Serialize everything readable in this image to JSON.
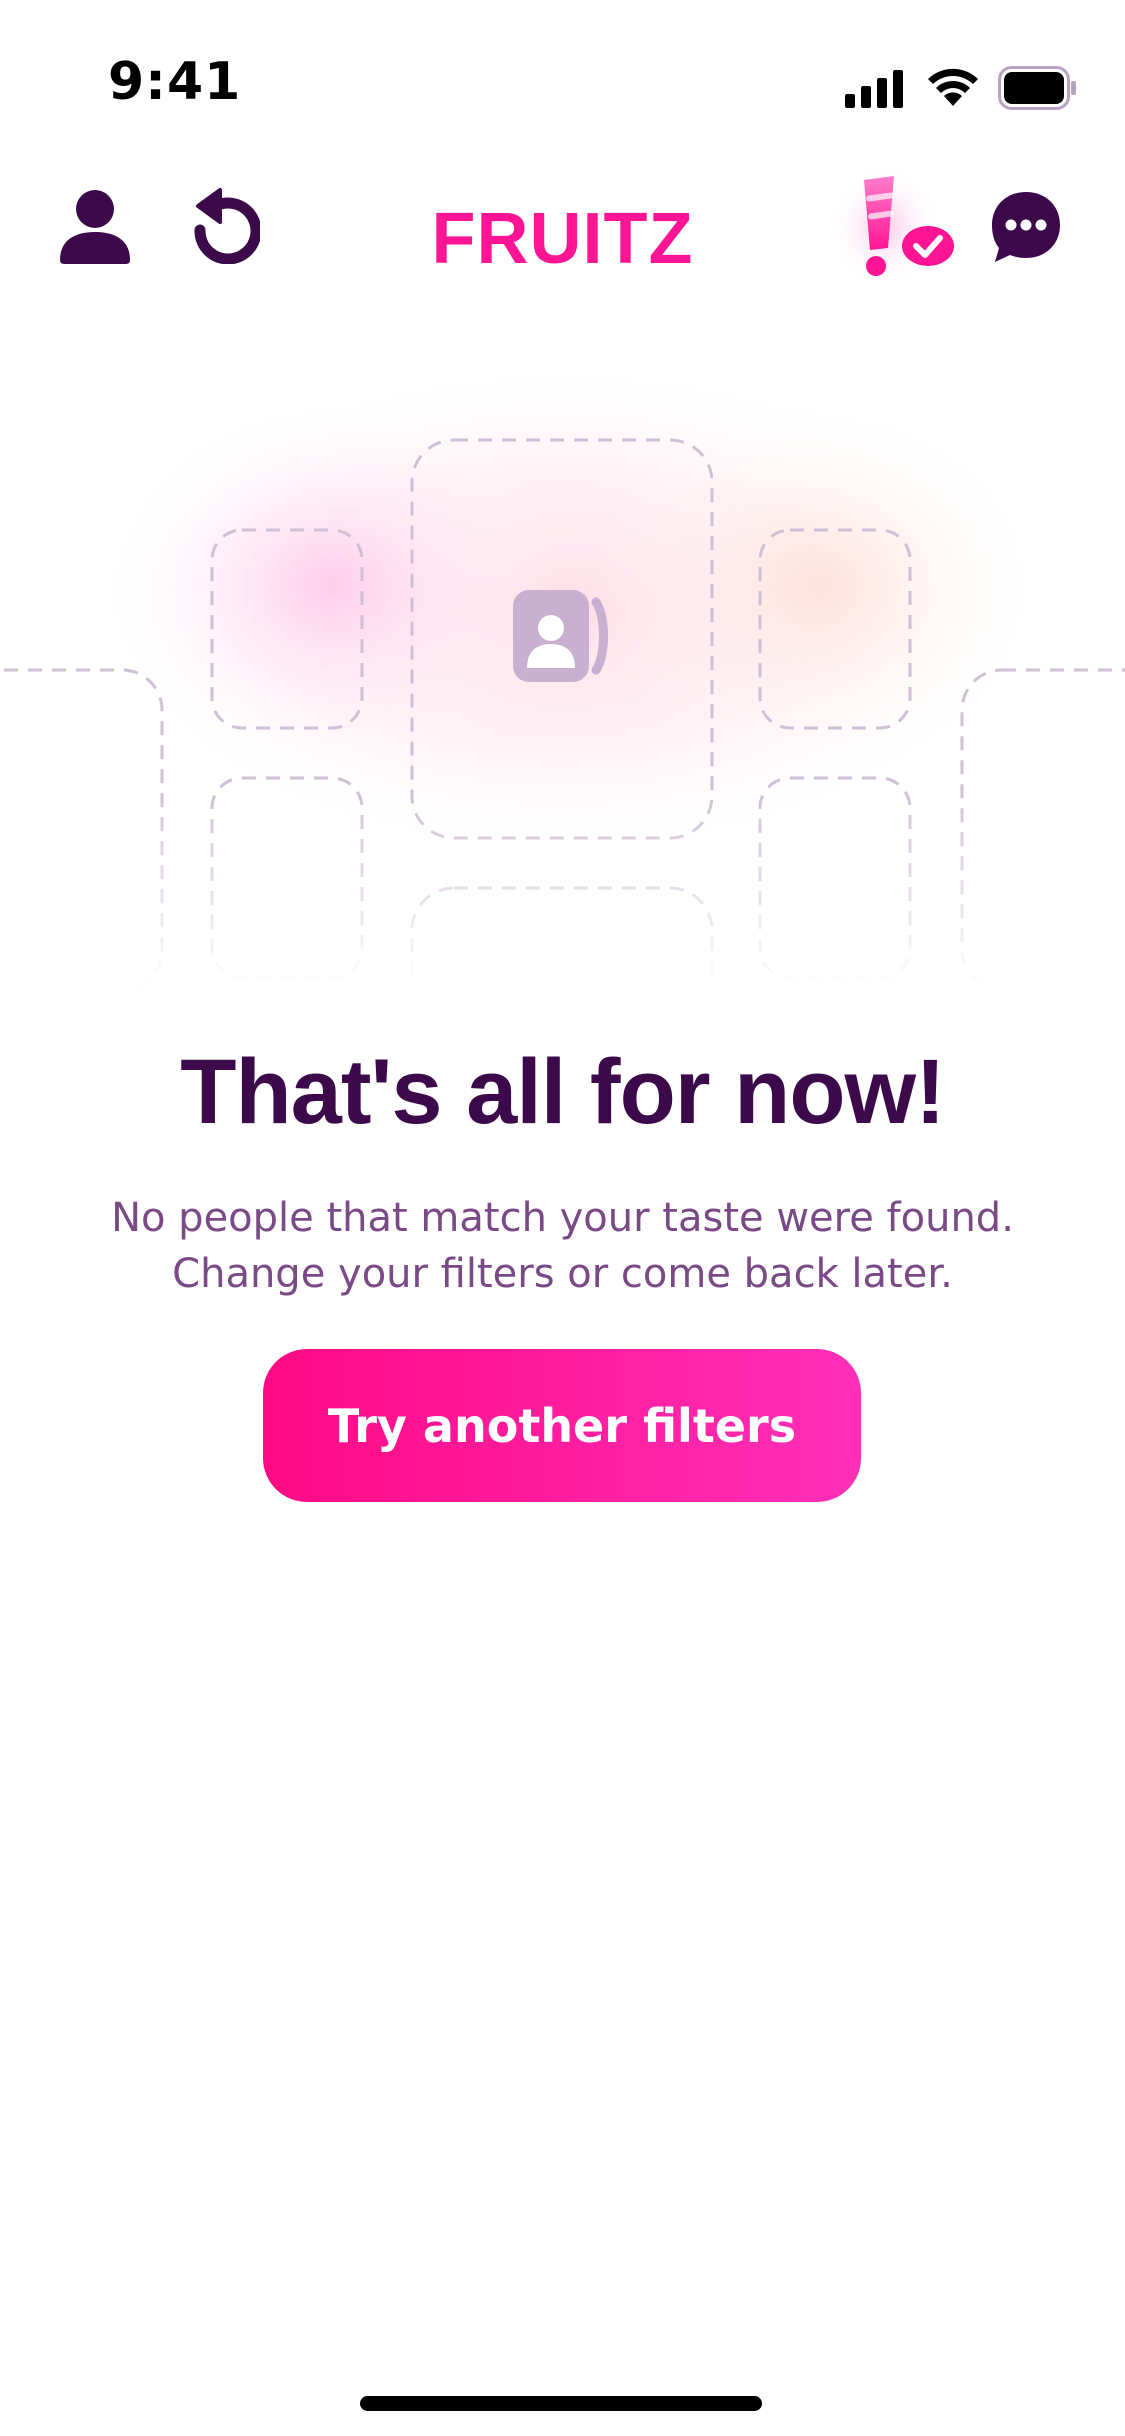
{
  "status_bar": {
    "time": "9:41"
  },
  "header": {
    "brand": "FRUITZ",
    "icons": [
      "profile-icon",
      "rewind-icon",
      "boost-icon",
      "chat-icon"
    ]
  },
  "empty_state": {
    "title": "That's all for now!",
    "message_line1": "No people that match your taste were found.",
    "message_line2": "Change your filters or come back later.",
    "button_label": "Try another filters"
  },
  "colors": {
    "brand_pink": "#ff1493",
    "title_purple": "#3c0a4b",
    "message_purple": "#7a4a87",
    "icon_purple": "#3c0a4b",
    "button_gradient_start": "#ff0a84",
    "button_gradient_end": "#ff2fb8"
  }
}
